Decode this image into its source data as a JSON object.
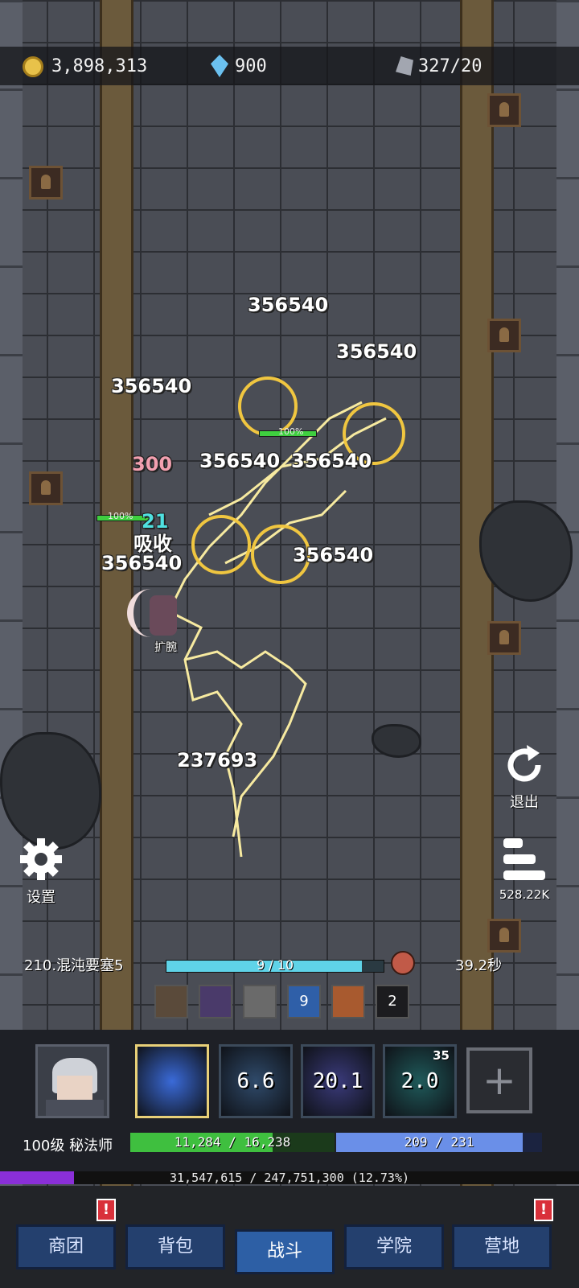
{
  "resources": {
    "gold": "3,898,313",
    "gems": "900",
    "ore": "327/20"
  },
  "damage_numbers": [
    "356540",
    "356540",
    "356540",
    "356540",
    "356540",
    "356540",
    "356540",
    "237693"
  ],
  "effect_numbers": {
    "pink_value": "300",
    "cyan_value": "21",
    "absorb_label": "吸收",
    "hero_tag": "扩腕",
    "enemy_hp_1": "100%",
    "enemy_hp_2": "100%"
  },
  "side_buttons": {
    "exit_label": "退出",
    "settings_label": "设置",
    "dps_value": "528.22K"
  },
  "stage": {
    "name": "210.混沌要塞5",
    "wave_text": "9 / 10",
    "wave_progress": 0.9,
    "timer": "39.2秒"
  },
  "buffs": [
    {
      "label": "",
      "color": "#5a4a3a"
    },
    {
      "label": "",
      "color": "#4a3a6a"
    },
    {
      "label": "",
      "color": "#6a6a6a"
    },
    {
      "label": "9",
      "color": "#2f5fa8"
    },
    {
      "label": "",
      "color": "#a85a2f"
    },
    {
      "label": "2",
      "color": "#1c1c1f"
    }
  ],
  "skills": [
    {
      "cooldown": "",
      "count": "",
      "color": "#3a6ad8"
    },
    {
      "cooldown": "6.6",
      "count": "",
      "color": "#2f4a6a"
    },
    {
      "cooldown": "20.1",
      "count": "",
      "color": "#3a3a7a"
    },
    {
      "cooldown": "2.0",
      "count": "35",
      "color": "#1f5a5a"
    }
  ],
  "player": {
    "level_class": "100级 秘法师",
    "hp_text": "11,284 / 16,238",
    "hp_fraction": 0.695,
    "mp_text": "209 / 231",
    "mp_fraction": 0.905,
    "xp_text": "31,547,615 / 247,751,300 (12.73%)",
    "xp_fraction": 0.1273
  },
  "nav": {
    "tabs": [
      "商团",
      "背包",
      "战斗",
      "学院",
      "营地"
    ],
    "active": "战斗",
    "alert_symbol": "!"
  },
  "colors": {
    "accent_hp": "#3fbf3f",
    "accent_mp": "#6a8fe8",
    "accent_xp": "#8a2fd8",
    "stage_bar": "#5fd3e8"
  }
}
